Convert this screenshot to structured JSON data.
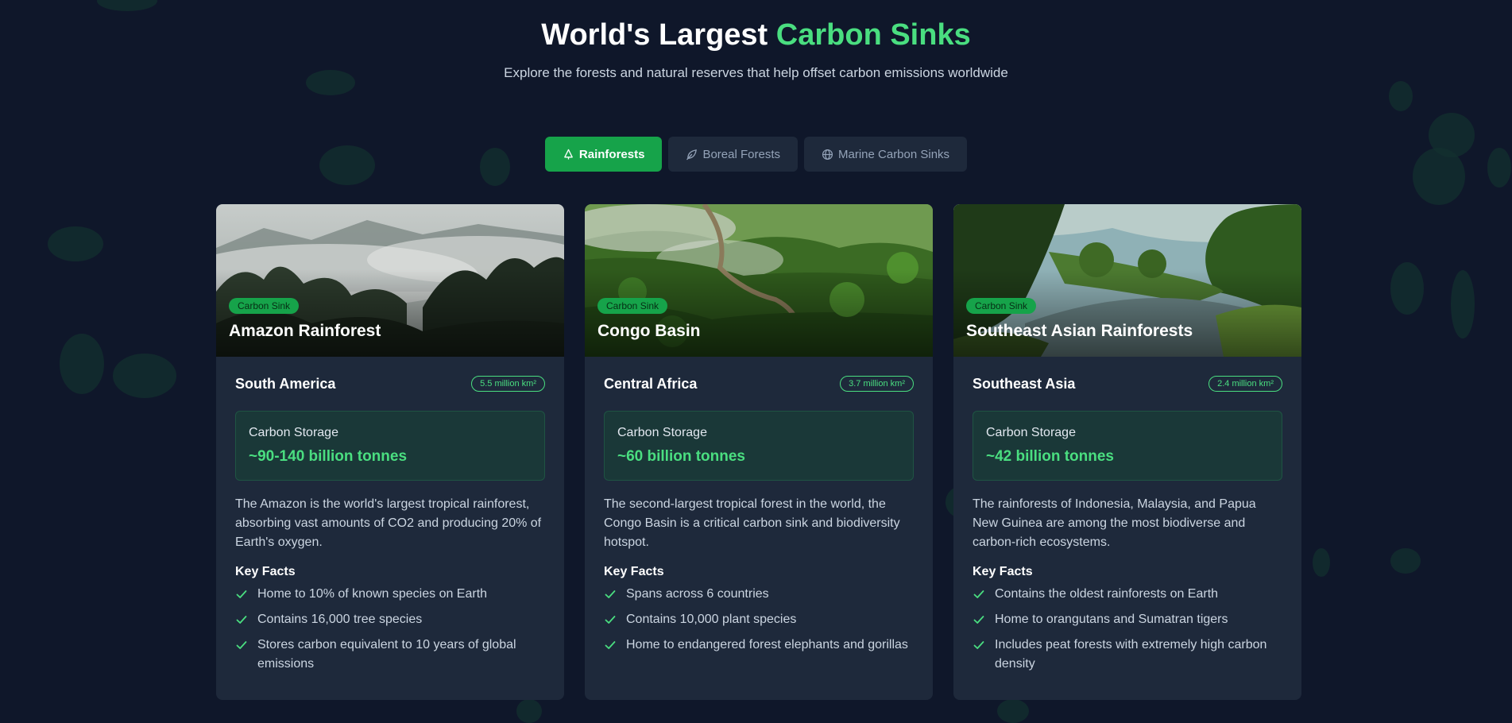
{
  "header": {
    "title_main": "World's Largest",
    "title_accent": "Carbon Sinks",
    "subtitle": "Explore the forests and natural reserves that help offset carbon emissions worldwide"
  },
  "tabs": [
    {
      "label": "Rainforests",
      "icon": "tree-icon",
      "active": true
    },
    {
      "label": "Boreal Forests",
      "icon": "leaf-icon",
      "active": false
    },
    {
      "label": "Marine Carbon Sinks",
      "icon": "globe-icon",
      "active": false
    }
  ],
  "colors": {
    "background": "#0f172a",
    "card": "#1e293b",
    "accent": "#4ade80",
    "active_tab": "#16a34a"
  },
  "cards": [
    {
      "badge": "Carbon Sink",
      "name": "Amazon Rainforest",
      "region": "South America",
      "area": "5.5 million km²",
      "storage_label": "Carbon Storage",
      "storage_value": "~90-140 billion tonnes",
      "description": "The Amazon is the world's largest tropical rainforest, absorbing vast amounts of CO2 and producing 20% of Earth's oxygen.",
      "facts_title": "Key Facts",
      "facts": [
        "Home to 10% of known species on Earth",
        "Contains 16,000 tree species",
        "Stores carbon equivalent to 10 years of global emissions"
      ]
    },
    {
      "badge": "Carbon Sink",
      "name": "Congo Basin",
      "region": "Central Africa",
      "area": "3.7 million km²",
      "storage_label": "Carbon Storage",
      "storage_value": "~60 billion tonnes",
      "description": "The second-largest tropical forest in the world, the Congo Basin is a critical carbon sink and biodiversity hotspot.",
      "facts_title": "Key Facts",
      "facts": [
        "Spans across 6 countries",
        "Contains 10,000 plant species",
        "Home to endangered forest elephants and gorillas"
      ]
    },
    {
      "badge": "Carbon Sink",
      "name": "Southeast Asian Rainforests",
      "region": "Southeast Asia",
      "area": "2.4 million km²",
      "storage_label": "Carbon Storage",
      "storage_value": "~42 billion tonnes",
      "description": "The rainforests of Indonesia, Malaysia, and Papua New Guinea are among the most biodiverse and carbon-rich ecosystems.",
      "facts_title": "Key Facts",
      "facts": [
        "Contains the oldest rainforests on Earth",
        "Home to orangutans and Sumatran tigers",
        "Includes peat forests with extremely high carbon density"
      ]
    }
  ]
}
